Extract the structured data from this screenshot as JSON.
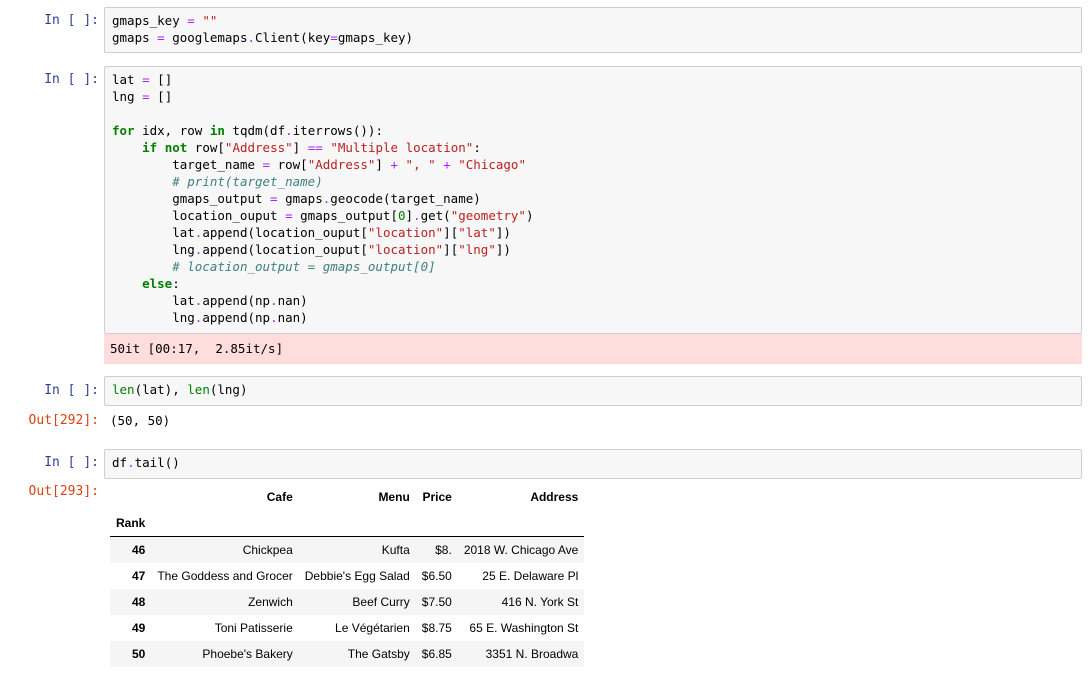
{
  "cells": [
    {
      "prompt": "In [ ]:",
      "lines": [
        [
          {
            "t": "gmaps_key "
          },
          {
            "t": "=",
            "c": "op"
          },
          {
            "t": " "
          },
          {
            "t": "\"\"",
            "c": "str"
          }
        ],
        [
          {
            "t": "gmaps "
          },
          {
            "t": "=",
            "c": "op"
          },
          {
            "t": " googlemaps"
          },
          {
            "t": ".",
            "c": "op"
          },
          {
            "t": "Client(key"
          },
          {
            "t": "=",
            "c": "op"
          },
          {
            "t": "gmaps_key)"
          }
        ]
      ]
    },
    {
      "prompt": "In [ ]:",
      "lines": [
        [
          {
            "t": "lat "
          },
          {
            "t": "=",
            "c": "op"
          },
          {
            "t": " []"
          }
        ],
        [
          {
            "t": "lng "
          },
          {
            "t": "=",
            "c": "op"
          },
          {
            "t": " []"
          }
        ],
        [
          {
            "t": ""
          }
        ],
        [
          {
            "t": "for",
            "c": "kw"
          },
          {
            "t": " idx, row "
          },
          {
            "t": "in",
            "c": "kw"
          },
          {
            "t": " tqdm(df"
          },
          {
            "t": ".",
            "c": "op"
          },
          {
            "t": "iterrows()):"
          }
        ],
        [
          {
            "t": "    "
          },
          {
            "t": "if",
            "c": "kw"
          },
          {
            "t": " "
          },
          {
            "t": "not",
            "c": "kw"
          },
          {
            "t": " row["
          },
          {
            "t": "\"Address\"",
            "c": "str"
          },
          {
            "t": "] "
          },
          {
            "t": "==",
            "c": "op"
          },
          {
            "t": " "
          },
          {
            "t": "\"Multiple location\"",
            "c": "str"
          },
          {
            "t": ":"
          }
        ],
        [
          {
            "t": "        target_name "
          },
          {
            "t": "=",
            "c": "op"
          },
          {
            "t": " row["
          },
          {
            "t": "\"Address\"",
            "c": "str"
          },
          {
            "t": "] "
          },
          {
            "t": "+",
            "c": "op"
          },
          {
            "t": " "
          },
          {
            "t": "\", \"",
            "c": "str"
          },
          {
            "t": " "
          },
          {
            "t": "+",
            "c": "op"
          },
          {
            "t": " "
          },
          {
            "t": "\"Chicago\"",
            "c": "str"
          }
        ],
        [
          {
            "t": "        "
          },
          {
            "t": "# print(target_name)",
            "c": "com"
          }
        ],
        [
          {
            "t": "        gmaps_output "
          },
          {
            "t": "=",
            "c": "op"
          },
          {
            "t": " gmaps"
          },
          {
            "t": ".",
            "c": "op"
          },
          {
            "t": "geocode(target_name)"
          }
        ],
        [
          {
            "t": "        location_ouput "
          },
          {
            "t": "=",
            "c": "op"
          },
          {
            "t": " gmaps_output["
          },
          {
            "t": "0",
            "c": "builtin"
          },
          {
            "t": "]"
          },
          {
            "t": ".",
            "c": "op"
          },
          {
            "t": "get("
          },
          {
            "t": "\"geometry\"",
            "c": "str"
          },
          {
            "t": ")"
          }
        ],
        [
          {
            "t": "        lat"
          },
          {
            "t": ".",
            "c": "op"
          },
          {
            "t": "append(location_ouput["
          },
          {
            "t": "\"location\"",
            "c": "str"
          },
          {
            "t": "]["
          },
          {
            "t": "\"lat\"",
            "c": "str"
          },
          {
            "t": "])"
          }
        ],
        [
          {
            "t": "        lng"
          },
          {
            "t": ".",
            "c": "op"
          },
          {
            "t": "append(location_ouput["
          },
          {
            "t": "\"location\"",
            "c": "str"
          },
          {
            "t": "]["
          },
          {
            "t": "\"lng\"",
            "c": "str"
          },
          {
            "t": "])"
          }
        ],
        [
          {
            "t": "        "
          },
          {
            "t": "# location_output = gmaps_output[0]",
            "c": "com"
          }
        ],
        [
          {
            "t": "    "
          },
          {
            "t": "else",
            "c": "kw"
          },
          {
            "t": ":"
          }
        ],
        [
          {
            "t": "        lat"
          },
          {
            "t": ".",
            "c": "op"
          },
          {
            "t": "append(np"
          },
          {
            "t": ".",
            "c": "op"
          },
          {
            "t": "nan)"
          }
        ],
        [
          {
            "t": "        lng"
          },
          {
            "t": ".",
            "c": "op"
          },
          {
            "t": "append(np"
          },
          {
            "t": ".",
            "c": "op"
          },
          {
            "t": "nan)"
          }
        ]
      ],
      "stderr": "50it [00:17,  2.85it/s]"
    },
    {
      "prompt": "In [ ]:",
      "lines": [
        [
          {
            "t": "len",
            "c": "builtin"
          },
          {
            "t": "(lat), "
          },
          {
            "t": "len",
            "c": "builtin"
          },
          {
            "t": "(lng)"
          }
        ]
      ],
      "out_prompt": "Out[292]:",
      "out_text": "(50, 50)"
    },
    {
      "prompt": "In [ ]:",
      "lines": [
        [
          {
            "t": "df"
          },
          {
            "t": ".",
            "c": "op"
          },
          {
            "t": "tail()"
          }
        ]
      ],
      "out_prompt": "Out[293]:"
    }
  ],
  "dataframe": {
    "columns": [
      "Cafe",
      "Menu",
      "Price",
      "Address"
    ],
    "index_name": "Rank",
    "rows": [
      {
        "idx": "46",
        "values": [
          "Chickpea",
          "Kufta",
          "$8.",
          "2018 W. Chicago Ave"
        ]
      },
      {
        "idx": "47",
        "values": [
          "The Goddess and Grocer",
          "Debbie's Egg Salad",
          "$6.50",
          "25 E. Delaware Pl"
        ]
      },
      {
        "idx": "48",
        "values": [
          "Zenwich",
          "Beef Curry",
          "$7.50",
          "416 N. York St"
        ]
      },
      {
        "idx": "49",
        "values": [
          "Toni Patisserie",
          "Le Végétarien",
          "$8.75",
          "65 E. Washington St"
        ]
      },
      {
        "idx": "50",
        "values": [
          "Phoebe's Bakery",
          "The Gatsby",
          "$6.85",
          "3351 N. Broadwa"
        ]
      }
    ]
  }
}
